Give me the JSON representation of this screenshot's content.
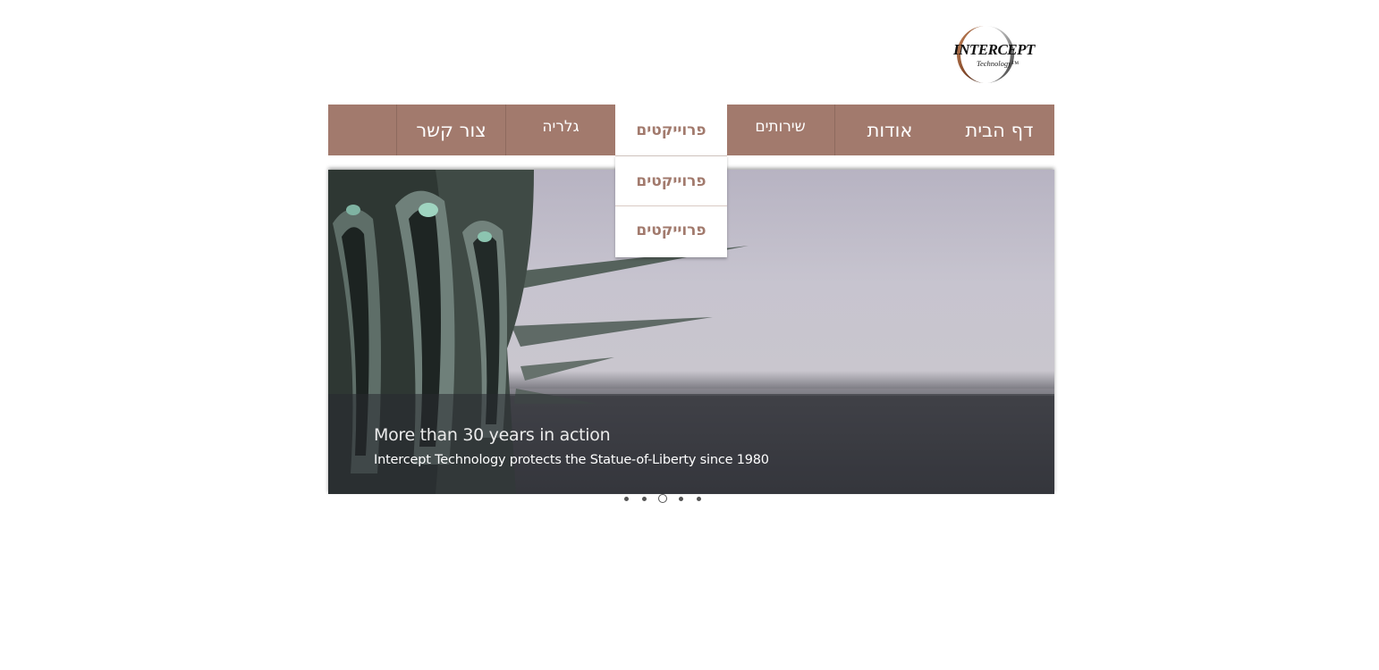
{
  "brand": {
    "logo_text": "INTERCEPT",
    "logo_subtext": "Technology™"
  },
  "nav": {
    "items": [
      {
        "label": "דף הבית"
      },
      {
        "label": "אודות"
      },
      {
        "label": "שירותים"
      },
      {
        "label": "פרוייקטים",
        "active": true
      },
      {
        "label": "גלריה"
      },
      {
        "label": "צור קשר"
      }
    ]
  },
  "dropdown": {
    "items": [
      {
        "label": "פרוייקטים"
      },
      {
        "label": "פרוייקטים"
      }
    ]
  },
  "slideshow": {
    "title": "More than 30 years in action",
    "subtitle": "Intercept Technology protects the Statue-of-Liberty since 1980",
    "slide_count": 5,
    "active_index": 2
  },
  "colors": {
    "nav_bg": "#a27a6d",
    "accent": "#a27a6d"
  }
}
